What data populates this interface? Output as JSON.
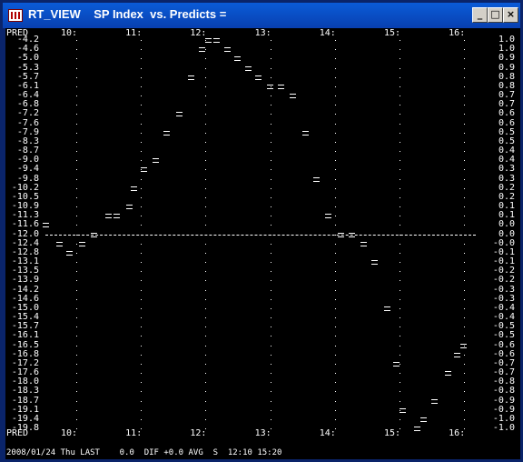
{
  "window": {
    "title": "RT_VIEW    SP Index  vs. Predicts =",
    "minimize_label": "_",
    "maximize_label": "□",
    "close_label": "×"
  },
  "chart_data": {
    "type": "scatter",
    "x_corner_label": "PRED",
    "x_ticks": [
      "10:",
      "11:",
      "12:",
      "13:",
      "14:",
      "15:",
      "16:"
    ],
    "y_left_ticks": [
      "-4.2",
      "-4.6",
      "-5.0",
      "-5.3",
      "-5.7",
      "-6.1",
      "-6.4",
      "-6.8",
      "-7.2",
      "-7.6",
      "-7.9",
      "-8.3",
      "-8.7",
      "-9.0",
      "-9.4",
      "-9.8",
      "-10.2",
      "-10.5",
      "-10.9",
      "-11.3",
      "-11.6",
      "-12.0",
      "-12.4",
      "-12.8",
      "-13.1",
      "-13.5",
      "-13.9",
      "-14.2",
      "-14.6",
      "-15.0",
      "-15.4",
      "-15.7",
      "-16.1",
      "-16.5",
      "-16.8",
      "-17.2",
      "-17.6",
      "-18.0",
      "-18.3",
      "-18.7",
      "-19.1",
      "-19.4",
      "-19.8"
    ],
    "y_right_ticks": [
      "1.0",
      "1.0",
      "0.9",
      "0.9",
      "0.8",
      "0.8",
      "0.7",
      "0.7",
      "0.6",
      "0.6",
      "0.5",
      "0.5",
      "0.4",
      "0.4",
      "0.3",
      "0.3",
      "0.2",
      "0.2",
      "0.1",
      "0.1",
      "0.0",
      "0.0",
      "-0.0",
      "-0.1",
      "-0.1",
      "-0.2",
      "-0.2",
      "-0.3",
      "-0.3",
      "-0.4",
      "-0.4",
      "-0.5",
      "-0.5",
      "-0.6",
      "-0.6",
      "-0.7",
      "-0.7",
      "-0.8",
      "-0.8",
      "-0.9",
      "-0.9",
      "-1.0",
      "-1.0"
    ],
    "x_range": [
      9.65,
      16.2
    ],
    "y_range": [
      -19.8,
      -4.2
    ],
    "reference_line_y": -12.0,
    "marker": "=",
    "points": [
      {
        "x": 9.63,
        "y": -11.6
      },
      {
        "x": 9.85,
        "y": -12.4
      },
      {
        "x": 10.0,
        "y": -12.8
      },
      {
        "x": 10.2,
        "y": -12.4
      },
      {
        "x": 10.38,
        "y": -12.0
      },
      {
        "x": 10.6,
        "y": -11.3
      },
      {
        "x": 10.73,
        "y": -11.3
      },
      {
        "x": 10.92,
        "y": -10.9
      },
      {
        "x": 11.0,
        "y": -10.2
      },
      {
        "x": 11.15,
        "y": -9.4
      },
      {
        "x": 11.33,
        "y": -9.0
      },
      {
        "x": 11.5,
        "y": -7.9
      },
      {
        "x": 11.7,
        "y": -7.2
      },
      {
        "x": 11.88,
        "y": -5.7
      },
      {
        "x": 12.05,
        "y": -4.6
      },
      {
        "x": 12.15,
        "y": -4.2
      },
      {
        "x": 12.27,
        "y": -4.2
      },
      {
        "x": 12.45,
        "y": -4.6
      },
      {
        "x": 12.6,
        "y": -5.0
      },
      {
        "x": 12.77,
        "y": -5.3
      },
      {
        "x": 12.92,
        "y": -5.7
      },
      {
        "x": 13.1,
        "y": -6.1
      },
      {
        "x": 13.27,
        "y": -6.1
      },
      {
        "x": 13.45,
        "y": -6.4
      },
      {
        "x": 13.65,
        "y": -7.9
      },
      {
        "x": 13.82,
        "y": -9.8
      },
      {
        "x": 14.0,
        "y": -11.3
      },
      {
        "x": 14.2,
        "y": -12.0
      },
      {
        "x": 14.37,
        "y": -12.0
      },
      {
        "x": 14.55,
        "y": -12.4
      },
      {
        "x": 14.72,
        "y": -13.1
      },
      {
        "x": 14.92,
        "y": -15.0
      },
      {
        "x": 15.05,
        "y": -17.2
      },
      {
        "x": 15.15,
        "y": -19.1
      },
      {
        "x": 15.38,
        "y": -19.8
      },
      {
        "x": 15.48,
        "y": -19.4
      },
      {
        "x": 15.65,
        "y": -18.7
      },
      {
        "x": 15.85,
        "y": -17.6
      },
      {
        "x": 16.0,
        "y": -16.8
      },
      {
        "x": 16.1,
        "y": -16.5
      }
    ]
  },
  "status_bar": {
    "text": "2008/01/24 Thu LAST    0.0  DIF +0.0 AVG  S  12:10 15:20"
  }
}
